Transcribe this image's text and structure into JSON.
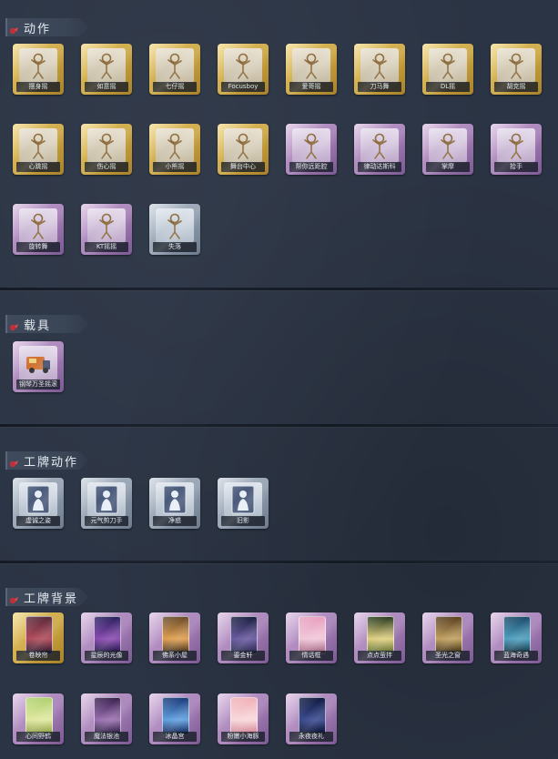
{
  "sections": [
    {
      "title": "动作",
      "items": [
        {
          "name": "摆身摇",
          "rarity": "gold"
        },
        {
          "name": "如意摇",
          "rarity": "gold"
        },
        {
          "name": "七仔摇",
          "rarity": "gold"
        },
        {
          "name": "Focusboy",
          "rarity": "gold"
        },
        {
          "name": "爱哥摇",
          "rarity": "gold"
        },
        {
          "name": "刀马舞",
          "rarity": "gold"
        },
        {
          "name": "DL摇",
          "rarity": "gold"
        },
        {
          "name": "胡克摇",
          "rarity": "gold"
        },
        {
          "name": "心跳摇",
          "rarity": "gold"
        },
        {
          "name": "伤心摇",
          "rarity": "gold"
        },
        {
          "name": "小熊摇",
          "rarity": "gold"
        },
        {
          "name": "舞台中心",
          "rarity": "gold"
        },
        {
          "name": "帮你远距腔",
          "rarity": "purple"
        },
        {
          "name": "律动达斯科",
          "rarity": "purple"
        },
        {
          "name": "掌摩",
          "rarity": "purple"
        },
        {
          "name": "拾手",
          "rarity": "purple"
        },
        {
          "name": "旋转舞",
          "rarity": "purple"
        },
        {
          "name": "KT摇摇",
          "rarity": "purple"
        },
        {
          "name": "失落",
          "rarity": "grey"
        }
      ]
    },
    {
      "title": "载具",
      "items": [
        {
          "name": "钢琴万圣摇滚",
          "rarity": "purple"
        }
      ]
    },
    {
      "title": "工牌动作",
      "items": [
        {
          "name": "虚诚之姿",
          "rarity": "grey"
        },
        {
          "name": "元气剪刀手",
          "rarity": "grey"
        },
        {
          "name": "净惑",
          "rarity": "grey"
        },
        {
          "name": "旧影",
          "rarity": "grey"
        }
      ]
    },
    {
      "title": "工牌背景",
      "items": [
        {
          "name": "卷映帘",
          "rarity": "gold"
        },
        {
          "name": "星辰的光像",
          "rarity": "purple"
        },
        {
          "name": "佛系小屋",
          "rarity": "purple"
        },
        {
          "name": "鎏金轩",
          "rarity": "purple"
        },
        {
          "name": "情话框",
          "rarity": "purple"
        },
        {
          "name": "点点萤拌",
          "rarity": "purple"
        },
        {
          "name": "圣光之窗",
          "rarity": "purple"
        },
        {
          "name": "蓝海奇遇",
          "rarity": "purple"
        },
        {
          "name": "心间野鹤",
          "rarity": "purple"
        },
        {
          "name": "魔法银池",
          "rarity": "purple"
        },
        {
          "name": "冰晶宫",
          "rarity": "purple"
        },
        {
          "name": "粉嫩小海豚",
          "rarity": "purple"
        },
        {
          "name": "永夜夜礼",
          "rarity": "purple"
        }
      ]
    }
  ],
  "colors": {
    "gold": "#c9a23c",
    "purple": "#a27bb4",
    "grey": "#8f9cad",
    "background": "#2b3444"
  },
  "icons": {
    "section_mark": "red-ribbon-icon",
    "action_card": "character-pose-icon",
    "vehicle_card": "food-truck-icon",
    "badge_action_card": "silhouette-card-icon",
    "badge_background_card": "frame-background-icon"
  }
}
